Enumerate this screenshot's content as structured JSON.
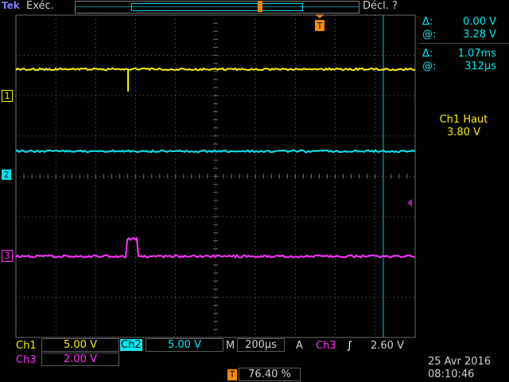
{
  "header": {
    "brand": "Tek",
    "run_state": "Exéc.",
    "trigger_state": "Décl. ?"
  },
  "cursors": {
    "v_delta": "0.00 V",
    "v_at": "3.28 V",
    "t_delta": "1.07ms",
    "t_at": "312µs",
    "delta_symbol": "Δ:",
    "at_symbol": "@:"
  },
  "measurement": {
    "label": "Ch1 Haut",
    "value": "3.80 V"
  },
  "channels": {
    "ch1": {
      "marker": "1",
      "label": "Ch1",
      "scale": "5.00 V"
    },
    "ch2": {
      "marker": "2",
      "label": "Ch2",
      "scale": "5.00 V"
    },
    "ch3": {
      "marker": "3",
      "label": "Ch3",
      "scale": "2.00 V"
    }
  },
  "timebase": {
    "label": "M",
    "value": "200µs"
  },
  "trigger": {
    "label": "A",
    "source": "Ch3",
    "slope": "∫",
    "level": "2.60 V",
    "marker": "T",
    "position": "76.40 %"
  },
  "datetime": {
    "date": "25 Avr  2016",
    "time": "08:10:46"
  },
  "colors": {
    "ch1": "#f4f000",
    "ch2": "#00e8f0",
    "ch3": "#ff30ff",
    "trigger": "#ff8a00",
    "grid": "#6a6a6a",
    "text": "#cfcfcf"
  }
}
